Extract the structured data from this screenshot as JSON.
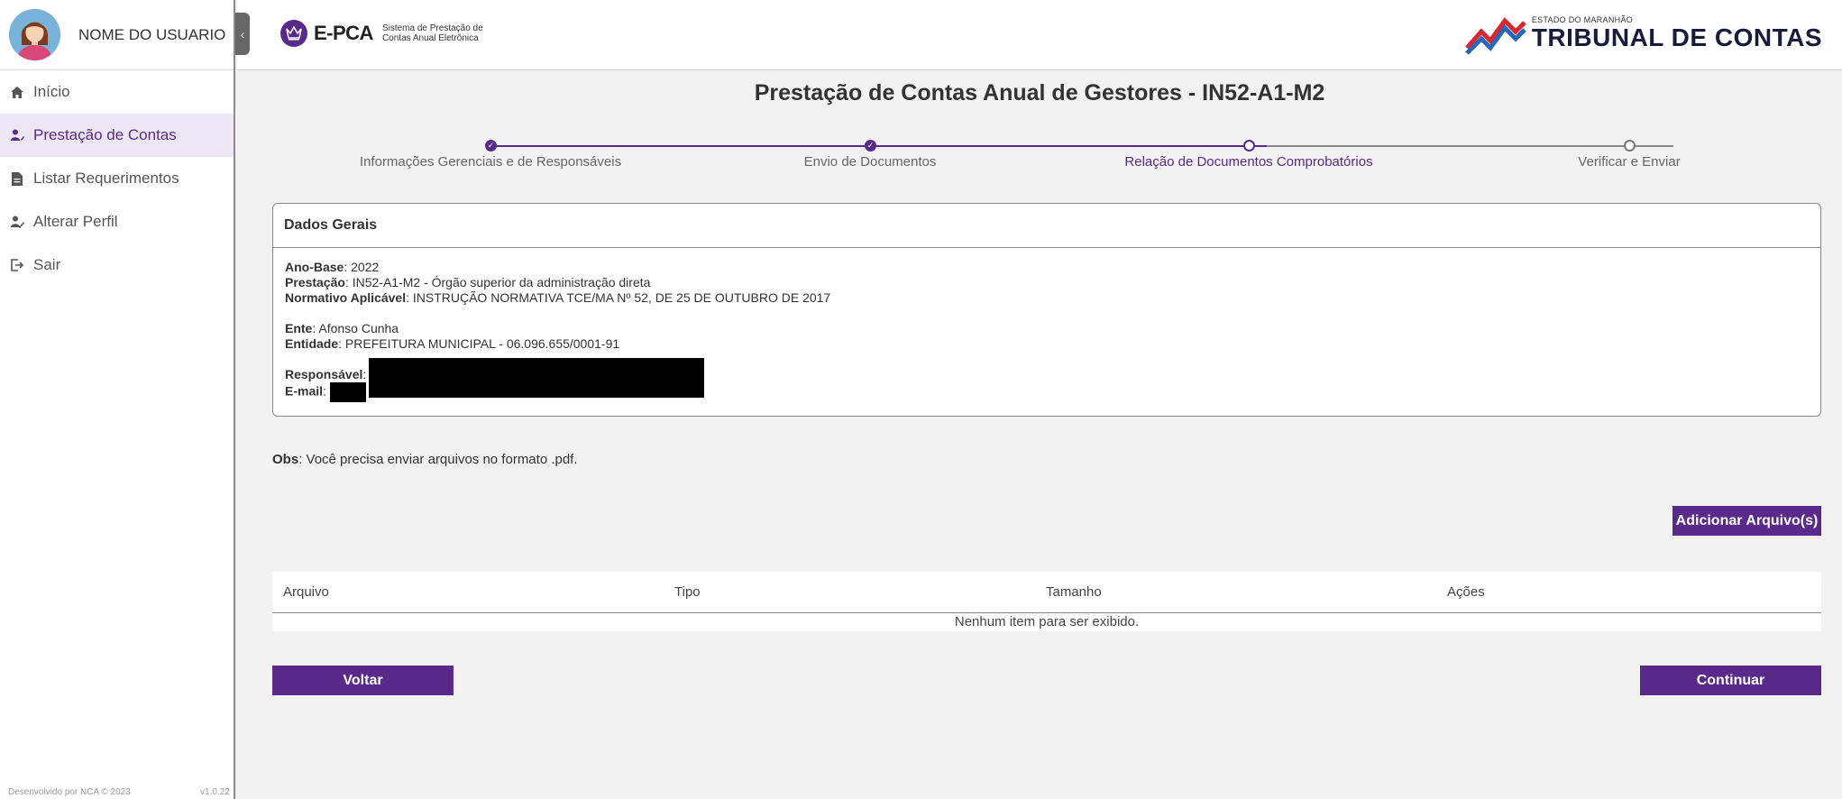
{
  "user": {
    "name": "NOME DO USUARIO"
  },
  "sidebar": {
    "items": [
      {
        "label": "Início",
        "icon": "home-icon"
      },
      {
        "label": "Prestação de Contas",
        "icon": "user-edit-icon",
        "active": true
      },
      {
        "label": "Listar Requerimentos",
        "icon": "document-icon"
      },
      {
        "label": "Alterar Perfil",
        "icon": "user-pen-icon"
      },
      {
        "label": "Sair",
        "icon": "logout-icon"
      }
    ],
    "footer": "Desenvolvido por NCA © 2023",
    "version": "v1.0.22"
  },
  "header": {
    "app_name": "E-PCA",
    "app_subtitle_1": "Sistema de Prestação de",
    "app_subtitle_2": "Contas Anual Eletrônica",
    "org_small": "ESTADO DO MARANHÃO",
    "org_big": "TRIBUNAL DE CONTAS"
  },
  "page": {
    "title": "Prestação de Contas Anual de Gestores - IN52-A1-M2"
  },
  "stepper": {
    "steps": [
      {
        "label": "Informações Gerenciais e de Responsáveis",
        "status": "done"
      },
      {
        "label": "Envio de Documentos",
        "status": "done"
      },
      {
        "label": "Relação de Documentos Comprobatórios",
        "status": "current"
      },
      {
        "label": "Verificar e Enviar",
        "status": "todo"
      }
    ]
  },
  "dados_gerais": {
    "title": "Dados Gerais",
    "ano_base_label": "Ano-Base",
    "ano_base": "2022",
    "prestacao_label": "Prestação",
    "prestacao": "IN52-A1-M2 - Órgão superior da administração direta",
    "normativo_label": "Normativo Aplicável",
    "normativo": "INSTRUÇÃO NORMATIVA TCE/MA Nº 52, DE 25 DE OUTUBRO DE 2017",
    "ente_label": "Ente",
    "ente": "Afonso Cunha",
    "entidade_label": "Entidade",
    "entidade": "PREFEITURA MUNICIPAL - 06.096.655/0001-91",
    "responsavel_label": "Responsável",
    "email_label": "E-mail"
  },
  "obs": {
    "label": "Obs",
    "text": ": Você precisa enviar arquivos no formato .pdf."
  },
  "actions": {
    "add_files": "Adicionar Arquivo(s)",
    "back": "Voltar",
    "next": "Continuar"
  },
  "table": {
    "columns": [
      "Arquivo",
      "Tipo",
      "Tamanho",
      "Ações"
    ],
    "empty": "Nenhum item para ser exibido."
  },
  "colors": {
    "accent": "#5a2a8a",
    "accent_light": "#ede6f4"
  }
}
